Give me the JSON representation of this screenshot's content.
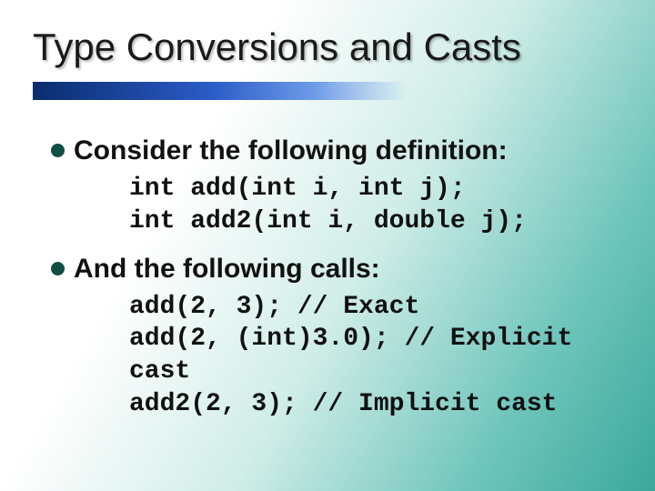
{
  "title": "Type Conversions and Casts",
  "bullet1": "Consider the following definition:",
  "code1_line1": "int add(int i, int j);",
  "code1_line2": "int add2(int i, double j);",
  "bullet2": "And the following calls:",
  "code2_line1": "add(2, 3); // Exact",
  "code2_line2": "add(2, (int)3.0); // Explicit cast",
  "code2_line3": "add2(2, 3); // Implicit cast"
}
